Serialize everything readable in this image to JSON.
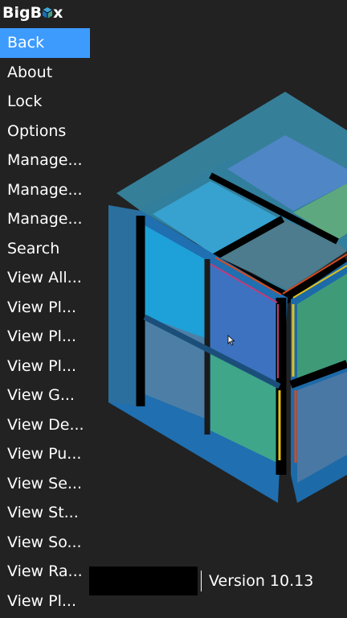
{
  "app": {
    "logo_text": "BigBox",
    "logo_prefix": "Big",
    "logo_suffix": "B",
    "logo_tail": "x"
  },
  "menu": {
    "items": [
      {
        "label": "Back",
        "selected": true
      },
      {
        "label": "About"
      },
      {
        "label": "Lock"
      },
      {
        "label": "Options"
      },
      {
        "label": "Manage..."
      },
      {
        "label": "Manage..."
      },
      {
        "label": "Manage..."
      },
      {
        "label": "Search"
      },
      {
        "label": "View All..."
      },
      {
        "label": "View Pl..."
      },
      {
        "label": "View Pl..."
      },
      {
        "label": "View Pl..."
      },
      {
        "label": "View G..."
      },
      {
        "label": "View De..."
      },
      {
        "label": "View Pu..."
      },
      {
        "label": "View Se..."
      },
      {
        "label": "View St..."
      },
      {
        "label": "View So..."
      },
      {
        "label": "View Ra..."
      },
      {
        "label": "View Pl..."
      }
    ]
  },
  "footer": {
    "version_text": "Version 10.13"
  },
  "colors": {
    "background": "#222222",
    "selection": "#3d9bfe",
    "text": "#ffffff"
  },
  "icons": {
    "logo_glyph": "cube-icon",
    "artwork": "bigbox-cube-icon",
    "cursor": "mouse-pointer-icon"
  }
}
